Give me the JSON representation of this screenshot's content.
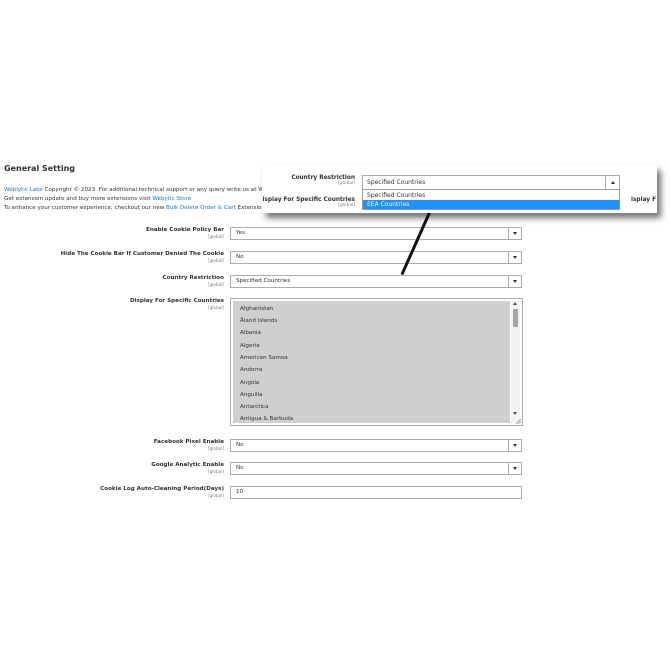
{
  "section": {
    "title": "General Setting"
  },
  "info": {
    "line1_brand": "Weblytic Labs",
    "line1_text": " Copyright © 2023. For additional technical support or any query write us at We",
    "line2_text": "Get extension update and buy more extensions visit ",
    "line2_link": "Webytic Store",
    "line3_text": "To enhance your customer experience, checkout our new ",
    "line3_link": "Bulk Delete Order & Cart",
    "line3_tail": " Extensio"
  },
  "scope_label": "[global]",
  "fields": {
    "cookie_bar": {
      "label": "Enable Cookie Policy Bar",
      "value": "Yes"
    },
    "hide_bar": {
      "label": "Hide The Cookie Bar If Customer Denied The Cookie",
      "value": "No"
    },
    "country_restriction": {
      "label": "Country Restriction",
      "value": "Specified Countries"
    },
    "specific_countries": {
      "label": "Display For Specific Countries",
      "options": [
        "Afghanistan",
        "Åland Islands",
        "Albania",
        "Algeria",
        "American Samoa",
        "Andorra",
        "Angola",
        "Anguilla",
        "Antarctica",
        "Antigua & Barbuda"
      ]
    },
    "facebook_pixel": {
      "label": "Facebook Pixel Enable",
      "value": "No"
    },
    "google_analytic": {
      "label": "Google Analytic Enable",
      "value": "No"
    },
    "cookie_log": {
      "label": "Cookie Log Auto-Cleaning Period(Days)",
      "value": "10"
    }
  },
  "zoom": {
    "label": "Country Restriction",
    "label2": "isplay For Specific Countries",
    "right_cut": "isplay F",
    "value": "Specified Countries",
    "options": [
      "Specified Countries",
      "EEA Countries"
    ],
    "selected_index": 1
  },
  "colors": {
    "link": "#1979c3",
    "highlight": "#1e90ff",
    "listbox_bg": "#cfcfcf"
  }
}
